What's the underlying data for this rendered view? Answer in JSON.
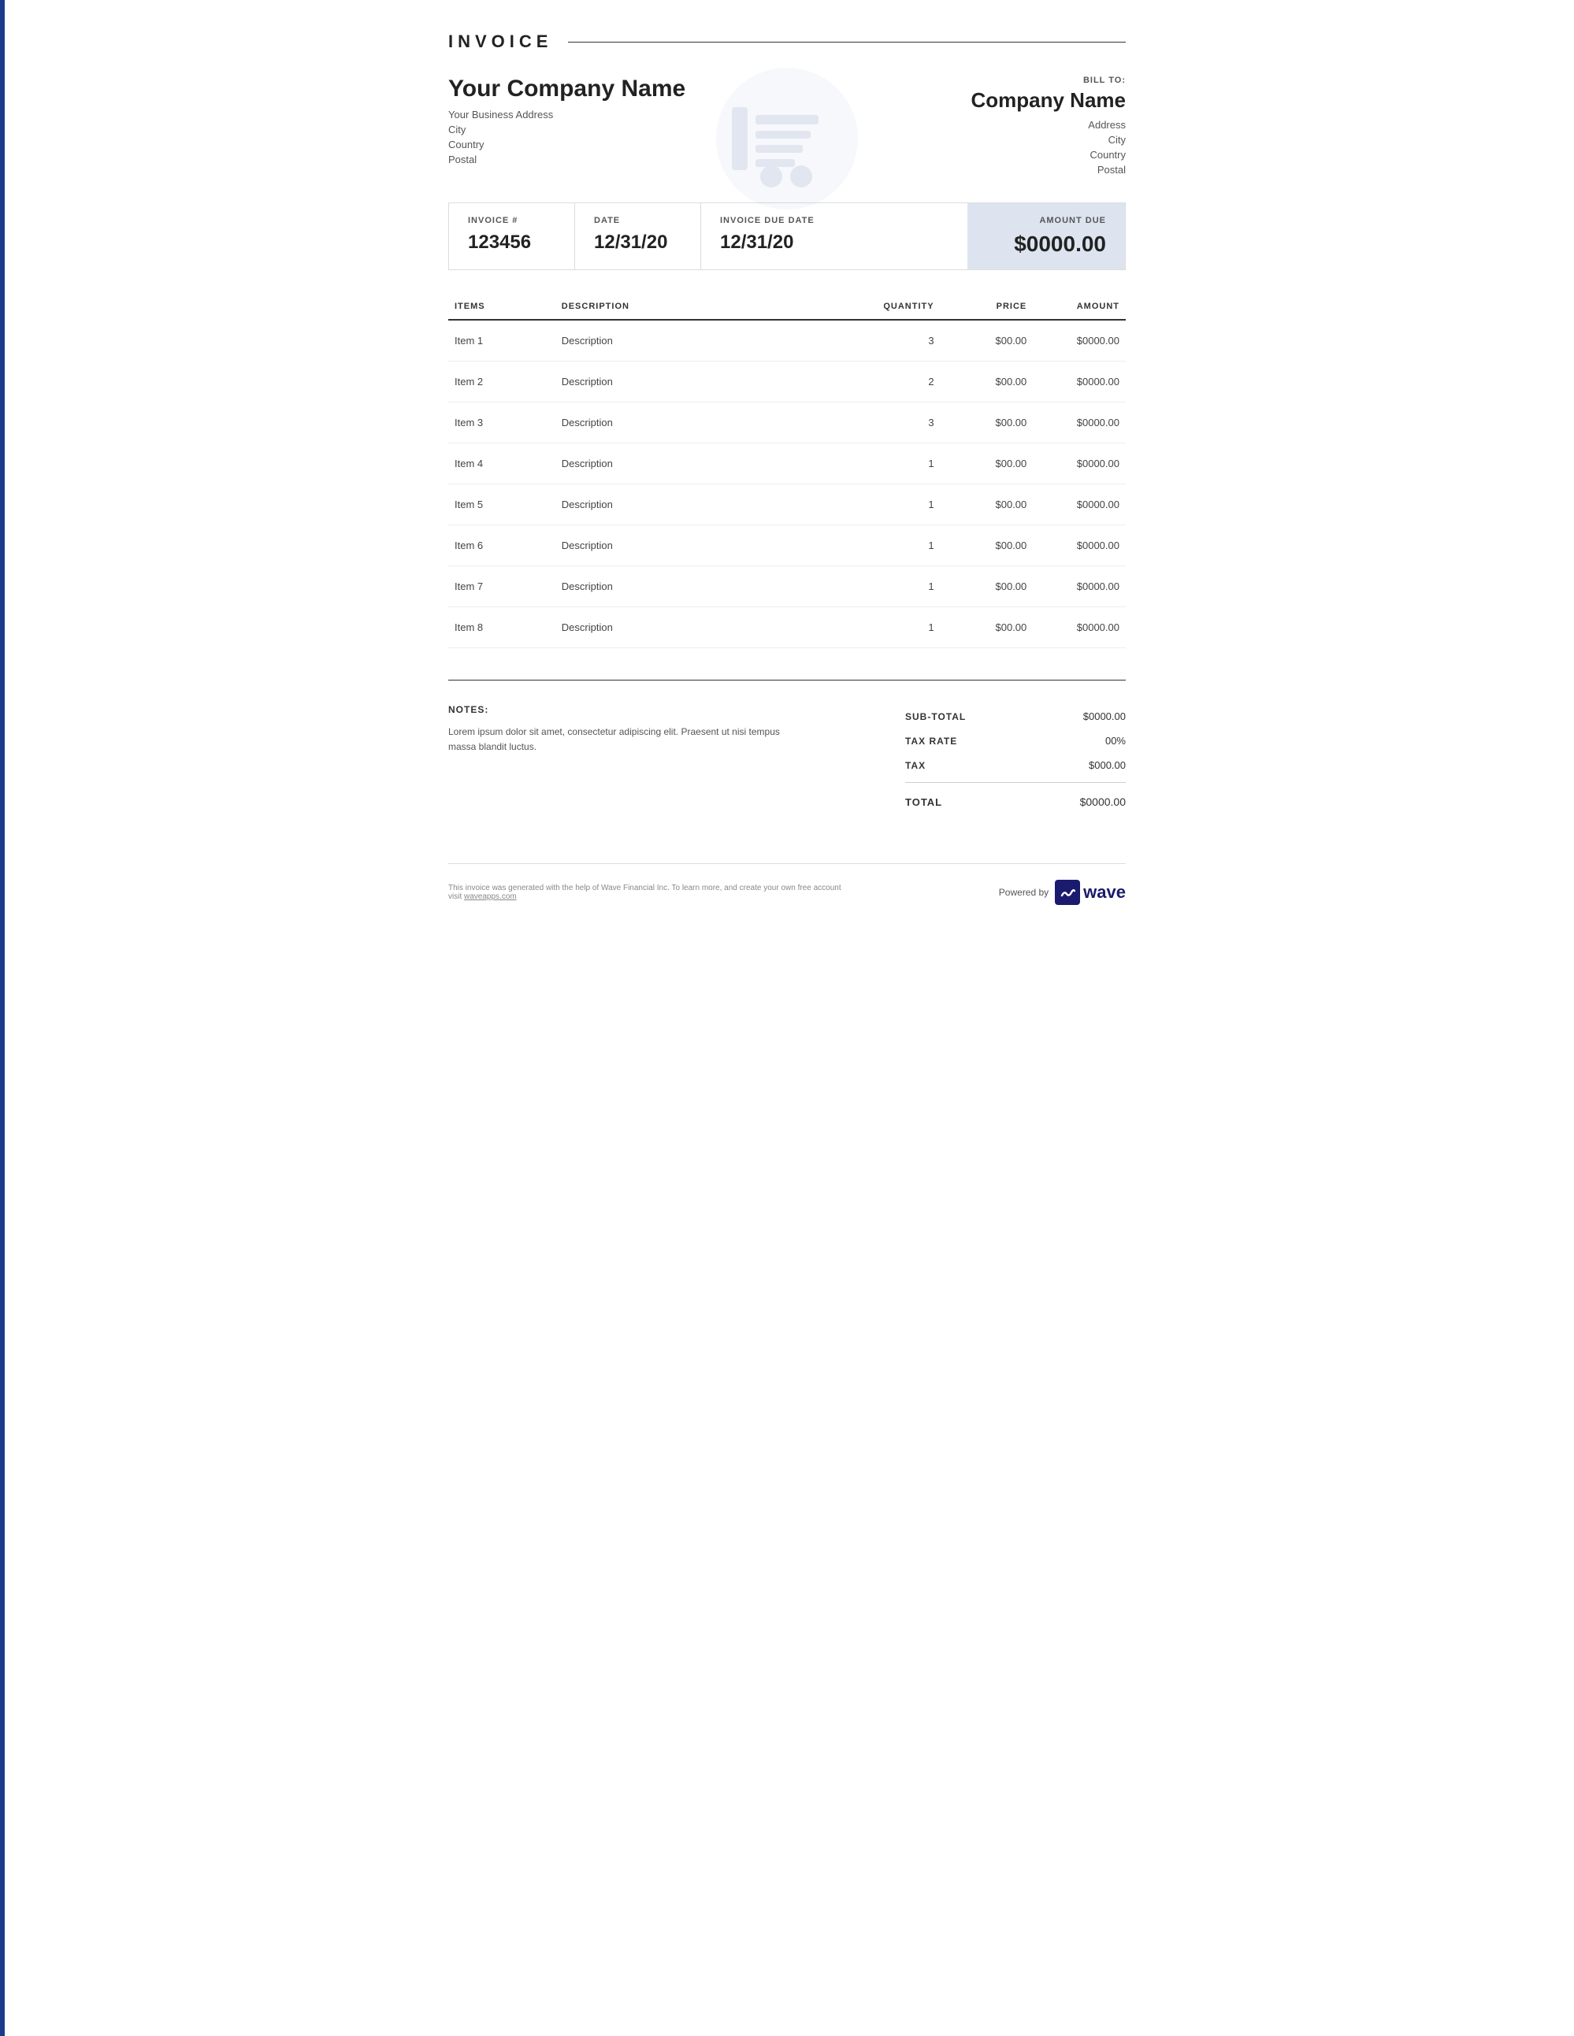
{
  "header": {
    "title": "INVOICE",
    "company_name": "Your Company Name",
    "address_line1": "Your Business Address",
    "address_city": "City",
    "address_country": "Country",
    "address_postal": "Postal"
  },
  "bill_to": {
    "label": "BILL TO:",
    "name": "Company Name",
    "address": "Address",
    "city": "City",
    "country": "Country",
    "postal": "Postal"
  },
  "invoice_details": {
    "number_label": "INVOICE #",
    "number_value": "123456",
    "date_label": "DATE",
    "date_value": "12/31/20",
    "due_date_label": "INVOICE DUE DATE",
    "due_date_value": "12/31/20",
    "amount_due_label": "AMOUNT DUE",
    "amount_due_value": "$0000.00"
  },
  "table": {
    "headers": {
      "items": "ITEMS",
      "description": "DESCRIPTION",
      "quantity": "QUANTITY",
      "price": "PRICE",
      "amount": "AMOUNT"
    },
    "rows": [
      {
        "item": "Item 1",
        "description": "Description",
        "quantity": "3",
        "price": "$00.00",
        "amount": "$0000.00"
      },
      {
        "item": "Item 2",
        "description": "Description",
        "quantity": "2",
        "price": "$00.00",
        "amount": "$0000.00"
      },
      {
        "item": "Item 3",
        "description": "Description",
        "quantity": "3",
        "price": "$00.00",
        "amount": "$0000.00"
      },
      {
        "item": "Item 4",
        "description": "Description",
        "quantity": "1",
        "price": "$00.00",
        "amount": "$0000.00"
      },
      {
        "item": "Item 5",
        "description": "Description",
        "quantity": "1",
        "price": "$00.00",
        "amount": "$0000.00"
      },
      {
        "item": "Item 6",
        "description": "Description",
        "quantity": "1",
        "price": "$00.00",
        "amount": "$0000.00"
      },
      {
        "item": "Item 7",
        "description": "Description",
        "quantity": "1",
        "price": "$00.00",
        "amount": "$0000.00"
      },
      {
        "item": "Item 8",
        "description": "Description",
        "quantity": "1",
        "price": "$00.00",
        "amount": "$0000.00"
      }
    ]
  },
  "notes": {
    "label": "NOTES:",
    "text": "Lorem ipsum dolor sit amet, consectetur adipiscing elit. Praesent ut nisi tempus massa blandit luctus."
  },
  "totals": {
    "subtotal_label": "SUB-TOTAL",
    "subtotal_value": "$0000.00",
    "tax_rate_label": "TAX RATE",
    "tax_rate_value": "00%",
    "tax_label": "TAX",
    "tax_value": "$000.00",
    "total_label": "TOTAL",
    "total_value": "$0000.00"
  },
  "footer": {
    "text": "This invoice was generated with the help of Wave Financial Inc. To learn more, and create your own free account visit",
    "link_text": "waveapps.com",
    "powered_by": "Powered by",
    "wave_label": "wave"
  }
}
